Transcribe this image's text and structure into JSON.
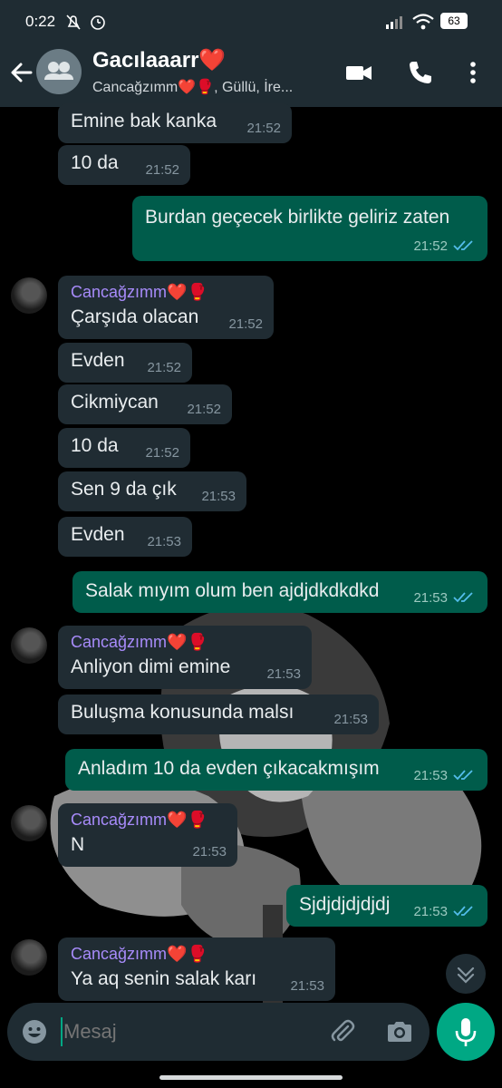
{
  "status": {
    "time": "0:22",
    "battery": "63"
  },
  "header": {
    "title": "Gacılaaarr❤️",
    "subtitle": "Cancağzımm❤️🥊, Güllü, İre..."
  },
  "messages": [
    {
      "dir": "in",
      "text": "Emine bak kanka",
      "time": "21:52"
    },
    {
      "dir": "in",
      "text": "10 da",
      "time": "21:52"
    },
    {
      "dir": "out",
      "text": "Burdan geçecek birlikte geliriz zaten",
      "time": "21:52"
    },
    {
      "dir": "in",
      "sender": "Cancağzımm❤️🥊",
      "text": "Çarşıda olacan",
      "time": "21:52"
    },
    {
      "dir": "in",
      "text": "Evden",
      "time": "21:52"
    },
    {
      "dir": "in",
      "text": "Cikmiycan",
      "time": "21:52"
    },
    {
      "dir": "in",
      "text": "10 da",
      "time": "21:52"
    },
    {
      "dir": "in",
      "text": "Sen 9 da çık",
      "time": "21:53"
    },
    {
      "dir": "in",
      "text": "Evden",
      "time": "21:53"
    },
    {
      "dir": "out",
      "text": "Salak mıyım olum ben ajdjdkdkdkd",
      "time": "21:53"
    },
    {
      "dir": "in",
      "sender": "Cancağzımm❤️🥊",
      "text": "Anliyon dimi emine",
      "time": "21:53"
    },
    {
      "dir": "in",
      "text": "Buluşma konusunda malsı",
      "time": "21:53"
    },
    {
      "dir": "out",
      "text": "Anladım 10 da evden çıkacakmışım",
      "time": "21:53"
    },
    {
      "dir": "in",
      "sender": "Cancağzımm❤️🥊",
      "text": "N",
      "time": "21:53"
    },
    {
      "dir": "out",
      "text": "Sjdjdjdjdjdj",
      "time": "21:53"
    },
    {
      "dir": "in",
      "sender": "Cancağzımm❤️🥊",
      "text": "Ya aq senin salak karı",
      "time": "21:53"
    }
  ],
  "composer": {
    "placeholder": "Mesaj"
  },
  "colors": {
    "bar_bg": "#1f2c33",
    "incoming_bubble": "#202c33",
    "outgoing_bubble": "#005c4b",
    "accent": "#00a884",
    "sender_name": "#a78bfa",
    "read_ticks": "#53bdeb"
  },
  "icons": [
    "back-arrow-icon",
    "group-avatar-icon",
    "video-call-icon",
    "phone-icon",
    "more-vert-icon",
    "emoji-icon",
    "attach-icon",
    "camera-icon",
    "mic-icon",
    "scroll-down-icon"
  ]
}
